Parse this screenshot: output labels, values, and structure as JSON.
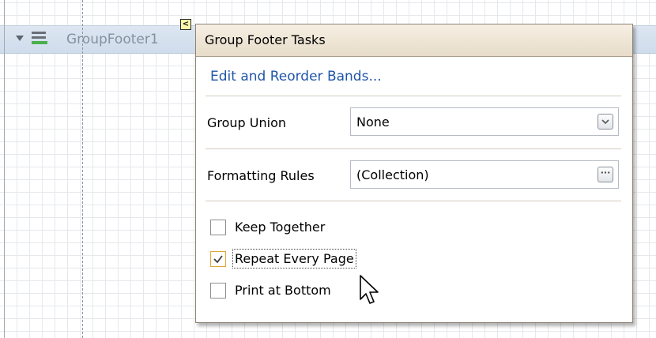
{
  "band": {
    "name": "GroupFooter1",
    "expand_icon": "triangle-down-icon",
    "band_icon": "group-footer-band-icon"
  },
  "smart_tag": {
    "glyph": "<",
    "icon": "collapse-arrow-icon"
  },
  "tasks_panel": {
    "title": "Group Footer Tasks",
    "edit_link": "Edit and Reorder Bands...",
    "group_union": {
      "label": "Group Union",
      "value": "None",
      "button_icon": "dropdown-chevron-icon"
    },
    "formatting_rules": {
      "label": "Formatting Rules",
      "value": "(Collection)",
      "button_glyph": "···",
      "button_icon": "ellipsis-icon"
    },
    "checkboxes": [
      {
        "label": "Keep Together",
        "checked": false
      },
      {
        "label": "Repeat Every Page",
        "checked": true
      },
      {
        "label": "Print at Bottom",
        "checked": false
      }
    ]
  },
  "colors": {
    "link": "#1f55a8",
    "header_bg": "#ebe1cf",
    "band_bg": "#d4dfee",
    "check_accent": "#e0a63a"
  }
}
